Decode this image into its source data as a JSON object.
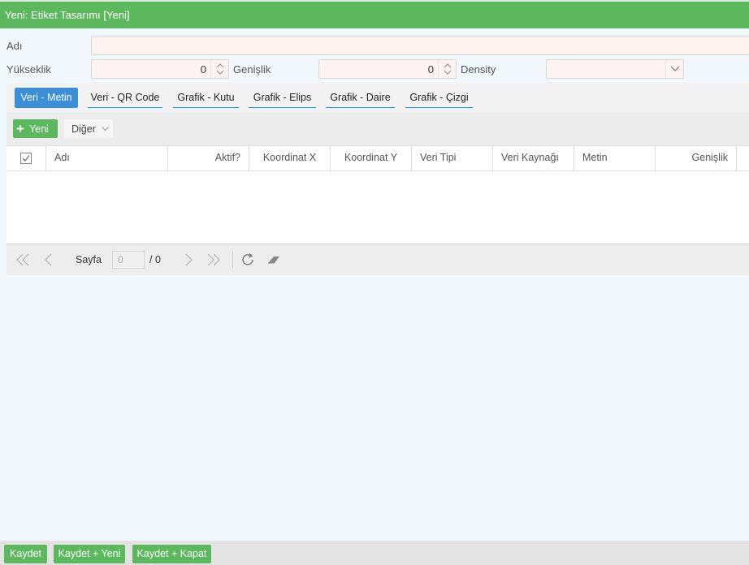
{
  "window": {
    "title": "Yeni: Etiket Tasarımı [Yeni]"
  },
  "form": {
    "name_label": "Adı",
    "name_value": "",
    "height_label": "Yükseklik",
    "height_value": "0",
    "width_label": "Genişlik",
    "width_value": "0",
    "density_label": "Density",
    "density_value": ""
  },
  "tabs": [
    {
      "label": "Veri - Metin",
      "active": true
    },
    {
      "label": "Veri - QR Code",
      "active": false
    },
    {
      "label": "Grafik - Kutu",
      "active": false
    },
    {
      "label": "Grafik - Elips",
      "active": false
    },
    {
      "label": "Grafik - Daire",
      "active": false
    },
    {
      "label": "Grafik - Çizgi",
      "active": false
    }
  ],
  "toolbar": {
    "new_label": "Yeni",
    "other_label": "Diğer"
  },
  "grid": {
    "columns": [
      "Adı",
      "Aktif?",
      "Koordinat X",
      "Koordinat Y",
      "Veri Tipi",
      "Veri Kaynağı",
      "Metin",
      "Genişlik"
    ],
    "rows": []
  },
  "pager": {
    "page_label": "Sayfa",
    "page_value": "0",
    "total": "/ 0"
  },
  "footer": {
    "save": "Kaydet",
    "save_new": "Kaydet + Yeni",
    "save_close": "Kaydet + Kapat"
  },
  "colors": {
    "primary_green": "#5cb85c",
    "active_tab_blue": "#3a8fd6",
    "input_bg": "#fef3ee"
  }
}
